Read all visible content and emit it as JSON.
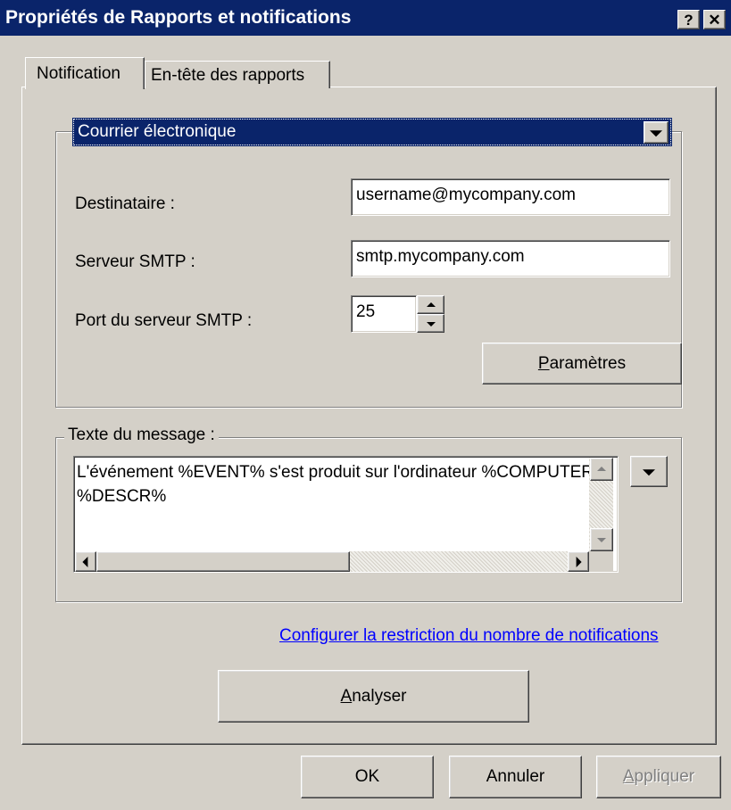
{
  "window": {
    "title": "Propriétés de Rapports et notifications",
    "help_button": "?",
    "close_button": "✕"
  },
  "tabs": [
    {
      "label": "Notification",
      "selected": true
    },
    {
      "label": "En-tête des rapports",
      "selected": false
    }
  ],
  "notification": {
    "method_selected": "Courrier électronique",
    "recipient_label": "Destinataire :",
    "recipient_value": "username@mycompany.com",
    "smtp_server_label": "Serveur SMTP :",
    "smtp_server_value": "smtp.mycompany.com",
    "smtp_port_label": "Port du serveur SMTP :",
    "smtp_port_value": "25",
    "parameters_button": {
      "prefix": "",
      "accel": "P",
      "rest": "aramètres"
    }
  },
  "message": {
    "group_label": "Texte du message :",
    "line1": "L'événement %EVENT% s'est produit sur l'ordinateur %COMPUTER%",
    "line2": "%DESCR%"
  },
  "restriction_link": "Configurer la restriction du nombre de notifications",
  "analyze_button": {
    "prefix": "",
    "accel": "A",
    "rest": "nalyser"
  },
  "footer": {
    "ok": "OK",
    "cancel": "Annuler",
    "apply": {
      "prefix": "",
      "accel": "A",
      "rest": "ppliquer"
    }
  },
  "colors": {
    "titlebar": "#0a246a",
    "face": "#d4d0c8",
    "selection": "#0a246a",
    "link": "#0000ff",
    "disabled_text": "#808080"
  }
}
